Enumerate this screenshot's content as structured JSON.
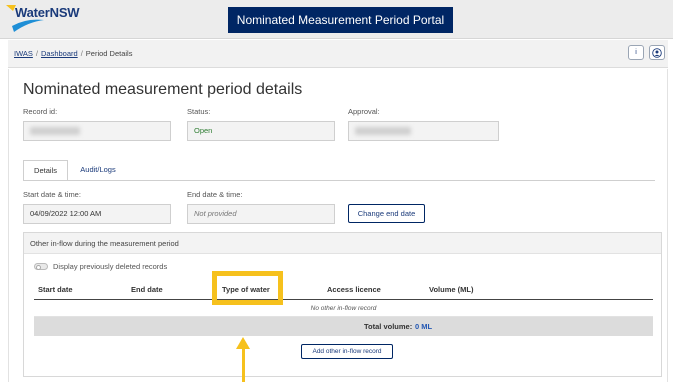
{
  "header": {
    "logo_text": "WaterNSW",
    "portal_title": "Nominated Measurement Period Portal"
  },
  "breadcrumb": {
    "items": [
      "IWAS",
      "Dashboard"
    ],
    "current": "Period Details",
    "separator": "/"
  },
  "header_buttons": {
    "info_icon": "info-icon",
    "user_icon": "user-icon"
  },
  "page": {
    "title": "Nominated measurement period details"
  },
  "record": {
    "record_id_label": "Record id:",
    "status_label": "Status:",
    "status_value": "Open",
    "approval_label": "Approval:"
  },
  "tabs": [
    {
      "label": "Details",
      "active": true
    },
    {
      "label": "Audit/Logs",
      "active": false
    }
  ],
  "details": {
    "start_label": "Start date & time:",
    "start_value": "04/09/2022 12:00 AM",
    "end_label": "End date & time:",
    "end_placeholder": "Not provided",
    "change_end_button": "Change end date"
  },
  "inflow": {
    "panel_title": "Other in-flow during the measurement period",
    "toggle_label": "Display previously deleted records",
    "columns": [
      "Start date",
      "End date",
      "Type of water",
      "Access licence",
      "Volume (ML)"
    ],
    "empty_message": "No other in-flow record",
    "total_label": "Total volume:",
    "total_value": "0 ML",
    "add_button": "Add other in-flow record"
  },
  "colors": {
    "brand_navy": "#002664",
    "highlight": "#f6c11d",
    "status_green": "#2e7d32",
    "total_blue": "#2458b3"
  }
}
